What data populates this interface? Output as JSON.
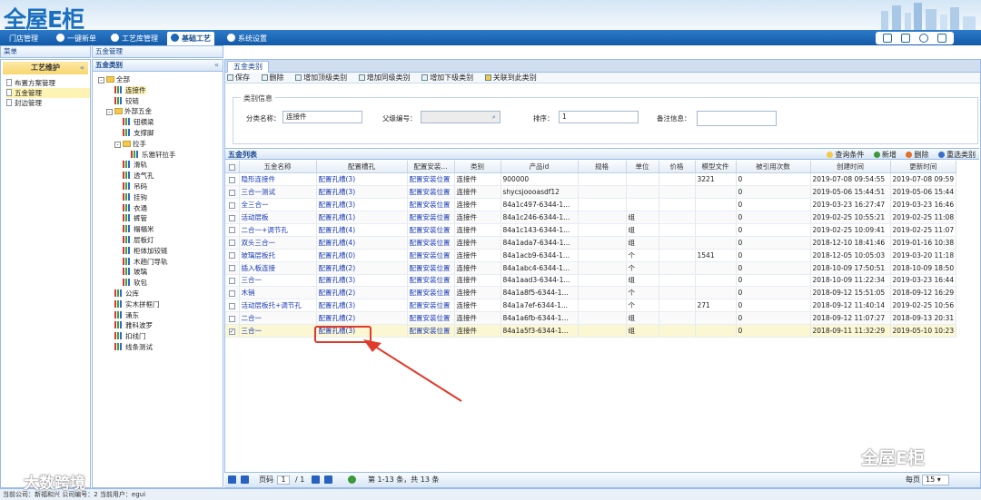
{
  "app": {
    "logo": "全屋E柜"
  },
  "nav": {
    "tabs": [
      "门店管理",
      "一键新单",
      "工艺库管理",
      "基础工艺",
      "系统设置"
    ]
  },
  "left": {
    "bar": "菜单",
    "title": "工艺维护",
    "collapse": "«",
    "items": [
      "布置方案管理",
      "五金管理",
      "封边管理"
    ]
  },
  "mid": {
    "bar": "五金管理",
    "title": "五金类别",
    "collapse": "«",
    "tree": [
      {
        "label": "全部",
        "level": 0,
        "icon": "folder",
        "toggle": "-"
      },
      {
        "label": "连接件",
        "level": 1,
        "icon": "bar",
        "selected": true
      },
      {
        "label": "铰链",
        "level": 1,
        "icon": "bar"
      },
      {
        "label": "外部五金",
        "level": 1,
        "icon": "folder",
        "toggle": "-"
      },
      {
        "label": "钮横梁",
        "level": 2,
        "icon": "bar"
      },
      {
        "label": "支撑脚",
        "level": 2,
        "icon": "bar"
      },
      {
        "label": "拉手",
        "level": 2,
        "icon": "folder",
        "toggle": "-"
      },
      {
        "label": "乐雅轩拉手",
        "level": 3,
        "icon": "bar"
      },
      {
        "label": "滑轨",
        "level": 2,
        "icon": "bar"
      },
      {
        "label": "透气孔",
        "level": 2,
        "icon": "bar"
      },
      {
        "label": "吊码",
        "level": 2,
        "icon": "bar"
      },
      {
        "label": "挂钩",
        "level": 2,
        "icon": "bar"
      },
      {
        "label": "衣通",
        "level": 2,
        "icon": "bar"
      },
      {
        "label": "裤管",
        "level": 2,
        "icon": "bar"
      },
      {
        "label": "榻榻米",
        "level": 2,
        "icon": "bar"
      },
      {
        "label": "层板灯",
        "level": 2,
        "icon": "bar"
      },
      {
        "label": "柜体加铰链",
        "level": 2,
        "icon": "bar"
      },
      {
        "label": "木趟门导轨",
        "level": 2,
        "icon": "bar"
      },
      {
        "label": "玻璃",
        "level": 2,
        "icon": "bar"
      },
      {
        "label": "软包",
        "level": 2,
        "icon": "bar"
      },
      {
        "label": "公库",
        "level": 1,
        "icon": "bar"
      },
      {
        "label": "实木拼框门",
        "level": 1,
        "icon": "bar"
      },
      {
        "label": "涌东",
        "level": 1,
        "icon": "bar"
      },
      {
        "label": "雅科波罗",
        "level": 1,
        "icon": "bar"
      },
      {
        "label": "扣线门",
        "level": 1,
        "icon": "bar"
      },
      {
        "label": "线条测试",
        "level": 1,
        "icon": "bar"
      }
    ]
  },
  "main": {
    "tab": "五金类别",
    "toolbar": [
      "保存",
      "删除",
      "增加顶级类别",
      "增加同级类别",
      "增加下级类别",
      "关联到此类别"
    ],
    "form": {
      "legend": "类别信息",
      "name_label": "分类名称：",
      "name_value": "连接件",
      "parent_label": "父级编号：",
      "sort_label": "排序：",
      "sort_value": "1",
      "remark_label": "备注信息："
    },
    "grid": {
      "title": "五金列表",
      "tools": [
        "查询条件",
        "新增",
        "删除",
        "重选类别"
      ],
      "columns": [
        "五金名称",
        "配置槽孔",
        "配置安装...",
        "类别",
        "产品id",
        "规格",
        "单位",
        "价格",
        "模型文件",
        "被引用次数",
        "创建时间",
        "更新时间"
      ],
      "rows": [
        [
          "隐形连接件",
          "配置孔槽(3)",
          "配置安装位置",
          "连接件",
          "900000",
          "",
          "",
          "",
          "3221",
          "0",
          "2019-07-08 09:54:55",
          "2019-07-08 09:59"
        ],
        [
          "三合一测试",
          "配置孔槽(3)",
          "配置安装位置",
          "连接件",
          "shycsjoooasdf12",
          "",
          "",
          "",
          "",
          "0",
          "2019-05-06 15:44:51",
          "2019-05-06 15:44"
        ],
        [
          "全三合一",
          "配置孔槽(3)",
          "配置安装位置",
          "连接件",
          "84a1c497-6344-1...",
          "",
          "",
          "",
          "",
          "0",
          "2019-03-23 16:27:47",
          "2019-03-23 16:46"
        ],
        [
          "活动层板",
          "配置孔槽(1)",
          "配置安装位置",
          "连接件",
          "84a1c246-6344-1...",
          "",
          "组",
          "",
          "",
          "0",
          "2019-02-25 10:55:21",
          "2019-02-25 11:08"
        ],
        [
          "二合一+调节孔",
          "配置孔槽(4)",
          "配置安装位置",
          "连接件",
          "84a1c143-6344-1...",
          "",
          "组",
          "",
          "",
          "0",
          "2019-02-25 10:09:41",
          "2019-02-25 11:07"
        ],
        [
          "双头三合一",
          "配置孔槽(4)",
          "配置安装位置",
          "连接件",
          "84a1ada7-6344-1...",
          "",
          "组",
          "",
          "",
          "0",
          "2018-12-10 18:41:46",
          "2019-01-16 10:38"
        ],
        [
          "玻璃层板托",
          "配置孔槽(0)",
          "配置安装位置",
          "连接件",
          "84a1acb9-6344-1...",
          "",
          "个",
          "",
          "1541",
          "0",
          "2018-12-05 10:05:03",
          "2019-03-20 11:18"
        ],
        [
          "插入板连接",
          "配置孔槽(2)",
          "配置安装位置",
          "连接件",
          "84a1abc4-6344-1...",
          "",
          "个",
          "",
          "",
          "0",
          "2018-10-09 17:50:51",
          "2018-10-09 18:50"
        ],
        [
          "三合一",
          "配置孔槽(3)",
          "配置安装位置",
          "连接件",
          "84a1aad3-6344-1...",
          "",
          "组",
          "",
          "",
          "0",
          "2018-10-09 11:22:34",
          "2019-03-23 16:44"
        ],
        [
          "木销",
          "配置孔槽(2)",
          "配置安装位置",
          "连接件",
          "84a1a8f5-6344-1...",
          "",
          "个",
          "",
          "",
          "0",
          "2018-09-12 15:51:05",
          "2018-09-12 16:29"
        ],
        [
          "活动层板托+调节孔",
          "配置孔槽(3)",
          "配置安装位置",
          "连接件",
          "84a1a7ef-6344-1...",
          "",
          "个",
          "",
          "271",
          "0",
          "2018-09-12 11:40:14",
          "2019-02-25 10:56"
        ],
        [
          "二合一",
          "配置孔槽(2)",
          "配置安装位置",
          "连接件",
          "84a1a6fb-6344-1...",
          "",
          "组",
          "",
          "",
          "0",
          "2018-09-12 11:07:27",
          "2018-09-13 20:31"
        ],
        [
          "三合一",
          "配置孔槽(3)",
          "配置安装位置",
          "连接件",
          "84a1a5f3-6344-1...",
          "",
          "组",
          "",
          "",
          "0",
          "2018-09-11 11:32:29",
          "2019-05-10 10:23"
        ]
      ]
    },
    "pager": {
      "page_label": "页码",
      "page": "1",
      "total_pages": "/ 1",
      "summary": "第 1-13 条，共 13 条",
      "per_page_label": "每页",
      "per_page": "15"
    }
  },
  "footer": "当前公司：新福和兴   公司编号：2   当前用户：egui",
  "watermarks": [
    "全屋E柜",
    "大数跨境"
  ]
}
